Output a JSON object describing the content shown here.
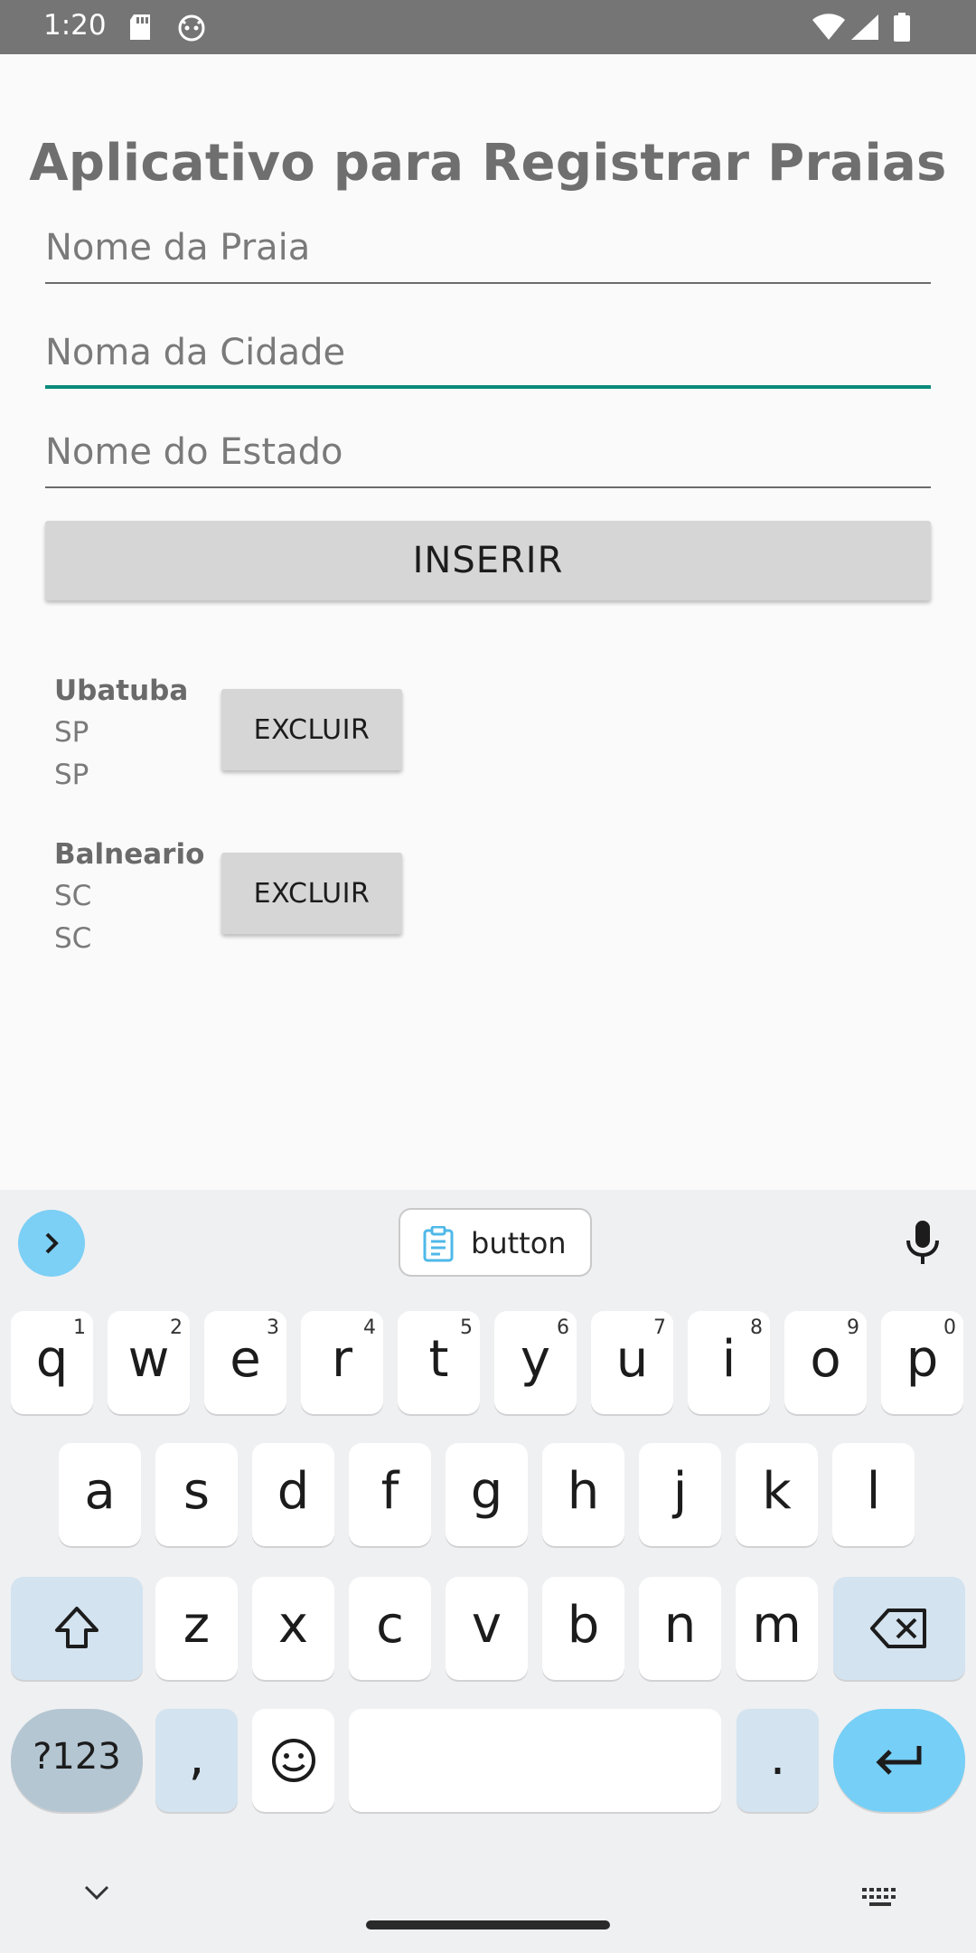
{
  "status_bar": {
    "time": "1:20"
  },
  "app": {
    "title": "Aplicativo para Registrar Praias",
    "fields": {
      "praia_placeholder": "Nome da Praia",
      "cidade_placeholder": "Noma da Cidade",
      "estado_placeholder": "Nome do Estado"
    },
    "insert_label": "INSERIR",
    "items": [
      {
        "name": "Ubatuba",
        "line2": "SP",
        "line3": "SP",
        "delete_label": "EXCLUIR"
      },
      {
        "name": "Balneario",
        "line2": "SC",
        "line3": "SC",
        "delete_label": "EXCLUIR"
      }
    ]
  },
  "keyboard": {
    "clipboard_suggestion": "button",
    "rows": [
      [
        {
          "k": "q",
          "h": "1"
        },
        {
          "k": "w",
          "h": "2"
        },
        {
          "k": "e",
          "h": "3"
        },
        {
          "k": "r",
          "h": "4"
        },
        {
          "k": "t",
          "h": "5"
        },
        {
          "k": "y",
          "h": "6"
        },
        {
          "k": "u",
          "h": "7"
        },
        {
          "k": "i",
          "h": "8"
        },
        {
          "k": "o",
          "h": "9"
        },
        {
          "k": "p",
          "h": "0"
        }
      ],
      [
        "a",
        "s",
        "d",
        "f",
        "g",
        "h",
        "j",
        "k",
        "l"
      ],
      [
        "z",
        "x",
        "c",
        "v",
        "b",
        "n",
        "m"
      ]
    ],
    "symbols_label": "?123",
    "comma": ",",
    "period": ".",
    "accent_color": "#76cff6",
    "focus_color": "#0a8a7a"
  }
}
